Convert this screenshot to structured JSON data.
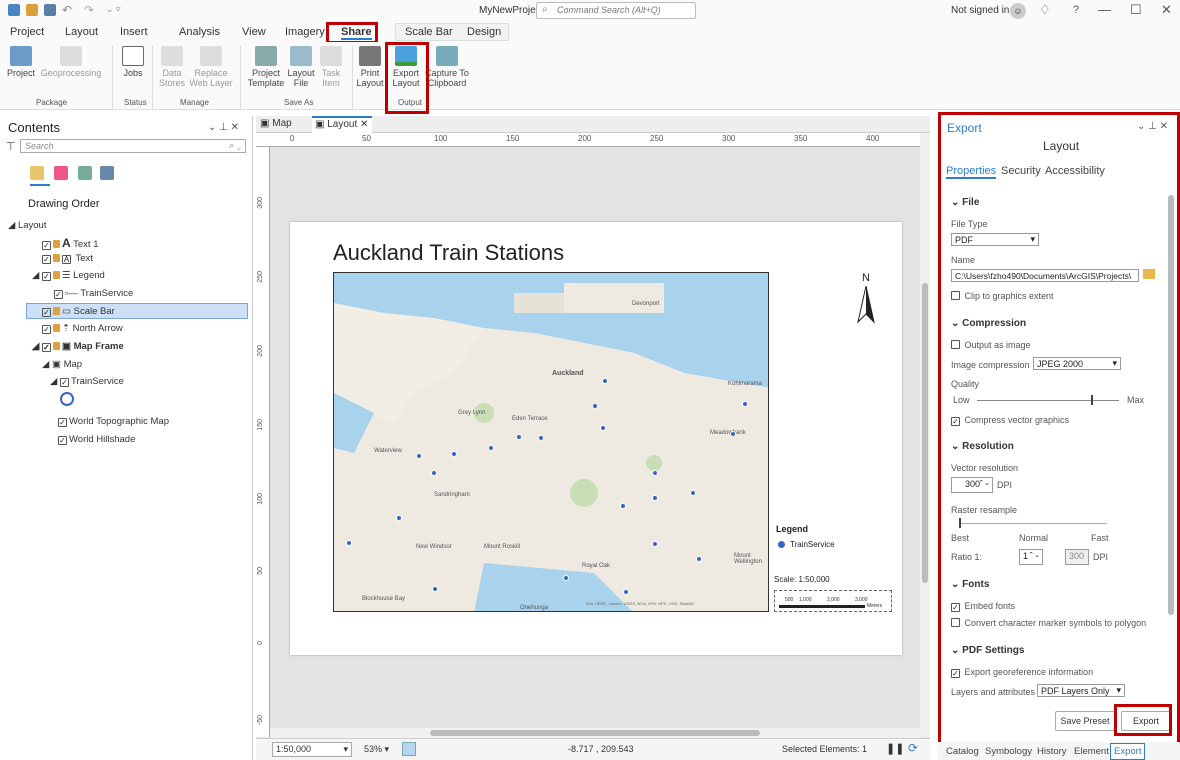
{
  "titlebar": {
    "project": "MyNewProject",
    "search_placeholder": "Command Search (Alt+Q)",
    "signin": "Not signed in",
    "help": "?",
    "minimize": "—",
    "maximize": "☐",
    "close": "✕"
  },
  "ribbon_tabs": [
    "Project",
    "Layout",
    "Insert",
    "Analysis",
    "View",
    "Imagery",
    "Share",
    "Scale Bar",
    "Design"
  ],
  "ribbon": {
    "project": "Project",
    "geoprocessing": "Geoprocessing",
    "jobs": "Jobs",
    "data_stores": "Data Stores",
    "replace": "Replace Web Layer",
    "project_template": "Project Template",
    "layout_file": "Layout File",
    "task_item": "Task Item",
    "print_layout": "Print Layout",
    "export_layout": "Export Layout",
    "capture": "Capture To Clipboard",
    "groups": {
      "package": "Package",
      "status": "Status",
      "manage": "Manage",
      "save_as": "Save As",
      "output": "Output"
    }
  },
  "contents": {
    "title": "Contents",
    "search_placeholder": "Search",
    "drawing_order": "Drawing Order",
    "items": {
      "layout": "Layout",
      "text1": "Text 1",
      "text": "Text",
      "legend": "Legend",
      "trainservice_leg": "TrainService",
      "scale_bar": "Scale Bar",
      "north_arrow": "North Arrow",
      "map_frame": "Map Frame",
      "map": "Map",
      "trainservice": "TrainService",
      "topo": "World Topographic Map",
      "hillshade": "World Hillshade"
    }
  },
  "view": {
    "tab_map": "Map",
    "tab_layout": "Layout",
    "ruler": [
      "0",
      "50",
      "100",
      "150",
      "200",
      "250",
      "300",
      "350",
      "400"
    ],
    "vruler": [
      "300",
      "250",
      "200",
      "150",
      "100",
      "50",
      "0",
      "-50"
    ],
    "layout_title": "Auckland Train Stations",
    "north": "N",
    "legend_title": "Legend",
    "legend_item": "TrainService",
    "scale_text": "Scale: 1:50,000",
    "scale_ticks": [
      "500",
      "1,000",
      "2,000",
      "3,000"
    ],
    "scale_unit": "Meters",
    "map_labels": {
      "auckland": "Auckland",
      "devonport": "Devonport",
      "greylynn": "Grey Lynn",
      "eden": "Eden Terrace",
      "waterview": "Waterview",
      "sandringham": "Sandringham",
      "newwindsor": "New Windsor",
      "mtroskill": "Mount Roskill",
      "royaloak": "Royal Oak",
      "meadowbank": "Meadowbank",
      "kohimarama": "Kohimarama",
      "blockhouse": "Blockhouse Bay",
      "onehunga": "Onehunga",
      "mtwell": "Mount Wellington"
    },
    "attribution": "Esri, HERE, Garmin, USGS, NGA, EPA, NPS, LINZ, StatsNZ"
  },
  "status": {
    "scale": "1:50,000",
    "zoom": "53%",
    "coords": "-8.717 , 209.543",
    "selected": "Selected Elements: 1"
  },
  "export": {
    "title": "Export",
    "subtitle": "Layout",
    "tabs": [
      "Properties",
      "Security",
      "Accessibility"
    ],
    "file_section": "File",
    "file_type_label": "File Type",
    "file_type": "PDF",
    "name_label": "Name",
    "name_value": "C:\\Users\\fzho490\\Documents\\ArcGIS\\Projects\\",
    "clip": "Clip to graphics extent",
    "compression_section": "Compression",
    "output_image": "Output as image",
    "image_compression_label": "Image compression",
    "image_compression": "JPEG 2000",
    "quality_label": "Quality",
    "low": "Low",
    "max": "Max",
    "compress_vector": "Compress vector graphics",
    "resolution_section": "Resolution",
    "vector_res_label": "Vector resolution",
    "vector_res": "300",
    "dpi": "DPI",
    "raster_label": "Raster resample",
    "best": "Best",
    "normal": "Normal",
    "fast": "Fast",
    "ratio_label": "Ratio 1:",
    "ratio": "1",
    "raster_dpi": "300",
    "fonts_section": "Fonts",
    "embed": "Embed fonts",
    "convert": "Convert character marker symbols to polygon",
    "pdf_section": "PDF Settings",
    "georef": "Export georeference information",
    "layers_label": "Layers and attributes",
    "layers": "PDF Layers Only",
    "save_preset": "Save Preset",
    "export_btn": "Export"
  },
  "bottom_tabs": [
    "Catalog",
    "Symbology",
    "History",
    "Element",
    "Export"
  ],
  "colors": {
    "accent": "#2b7cd3",
    "highlight": "#c00000",
    "water": "#a9d3ec",
    "selected_row": "#cde0f5"
  }
}
